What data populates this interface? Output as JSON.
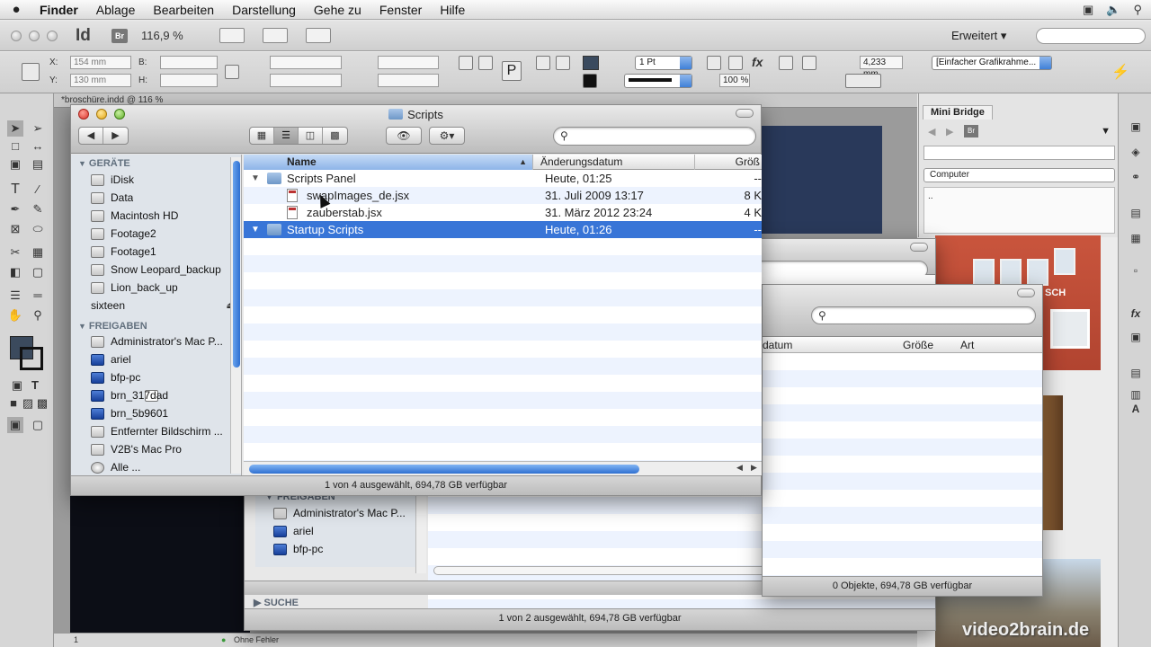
{
  "menubar": {
    "app": "Finder",
    "items": [
      "Ablage",
      "Bearbeiten",
      "Darstellung",
      "Gehe zu",
      "Fenster",
      "Hilfe"
    ]
  },
  "indesign": {
    "logo": "Id",
    "bridge_button": "Br",
    "zoom": "116,9 %",
    "workspace": "Erweitert",
    "x_label": "X:",
    "y_label": "Y:",
    "w_label": "B:",
    "h_label": "H:",
    "x_value": "154 mm",
    "y_value": "130 mm",
    "stroke_weight": "1 Pt",
    "opacity": "100 %",
    "ref_value": "4,233 mm",
    "object_style": "[Einfacher Grafikrahme...",
    "fx_label": "fx",
    "doc_tab": "*broschüre.indd @ 116 %",
    "status_page": "1",
    "status_errors": "Ohne Fehler"
  },
  "mini_bridge": {
    "title": "Mini Bridge",
    "location": "Computer",
    "body": ".."
  },
  "front_finder": {
    "title": "Scripts",
    "sidebar": {
      "devices_header": "GERÄTE",
      "devices": [
        {
          "label": "iDisk",
          "icon": "idisk-icon"
        },
        {
          "label": "Data",
          "icon": "hard-drive-icon"
        },
        {
          "label": "Macintosh HD",
          "icon": "hard-drive-icon"
        },
        {
          "label": "Footage2",
          "icon": "hard-drive-icon"
        },
        {
          "label": "Footage1",
          "icon": "hard-drive-icon"
        },
        {
          "label": "Snow Leopard_backup",
          "icon": "hard-drive-icon"
        },
        {
          "label": "Lion_back_up",
          "icon": "hard-drive-icon"
        },
        {
          "label": "sixteen",
          "icon": "disk-icon"
        }
      ],
      "shared_header": "FREIGABEN",
      "shared": [
        {
          "label": "Administrator's Mac P...",
          "icon": "computer-icon"
        },
        {
          "label": "ariel",
          "icon": "network-icon"
        },
        {
          "label": "bfp-pc",
          "icon": "network-icon"
        },
        {
          "label": "brn_317dad",
          "icon": "network-icon"
        },
        {
          "label": "brn_5b9601",
          "icon": "network-icon"
        },
        {
          "label": "Entfernter Bildschirm ...",
          "icon": "computer-icon"
        },
        {
          "label": "V2B's Mac Pro",
          "icon": "computer-icon"
        },
        {
          "label": "Alle ...",
          "icon": "network-icon"
        }
      ]
    },
    "columns": {
      "name": "Name",
      "date": "Änderungsdatum",
      "size": "Größ"
    },
    "rows": [
      {
        "name": "Scripts Panel",
        "date": "Heute, 01:25",
        "size": "--",
        "kind": "folder",
        "level": 0,
        "selected": false
      },
      {
        "name": "swapImages_de.jsx",
        "date": "31. Juli 2009 13:17",
        "size": "8 K",
        "kind": "file",
        "level": 1,
        "selected": false
      },
      {
        "name": "zauberstab.jsx",
        "date": "31. März 2012 23:24",
        "size": "4 K",
        "kind": "file",
        "level": 1,
        "selected": false
      },
      {
        "name": "Startup Scripts",
        "date": "Heute, 01:26",
        "size": "--",
        "kind": "folder",
        "level": 0,
        "selected": true
      }
    ],
    "status": "1 von 4 ausgewählt, 694,78 GB verfügbar"
  },
  "back_finder_a": {
    "columns": {
      "date": "datum",
      "size": "Größe",
      "kind": "Art"
    },
    "status": "0 Objekte, 694,78 GB verfügbar"
  },
  "back_finder_b": {
    "sidebar_header": "FREIGABEN",
    "sidebar_items": [
      "Administrator's Mac P...",
      "ariel",
      "bfp-pc"
    ],
    "search_header": "SUCHE",
    "status": "1 von 2 ausgewählt, 694,78 GB verfügbar"
  },
  "photo_text": "SCH",
  "watermark": "video2brain.de"
}
